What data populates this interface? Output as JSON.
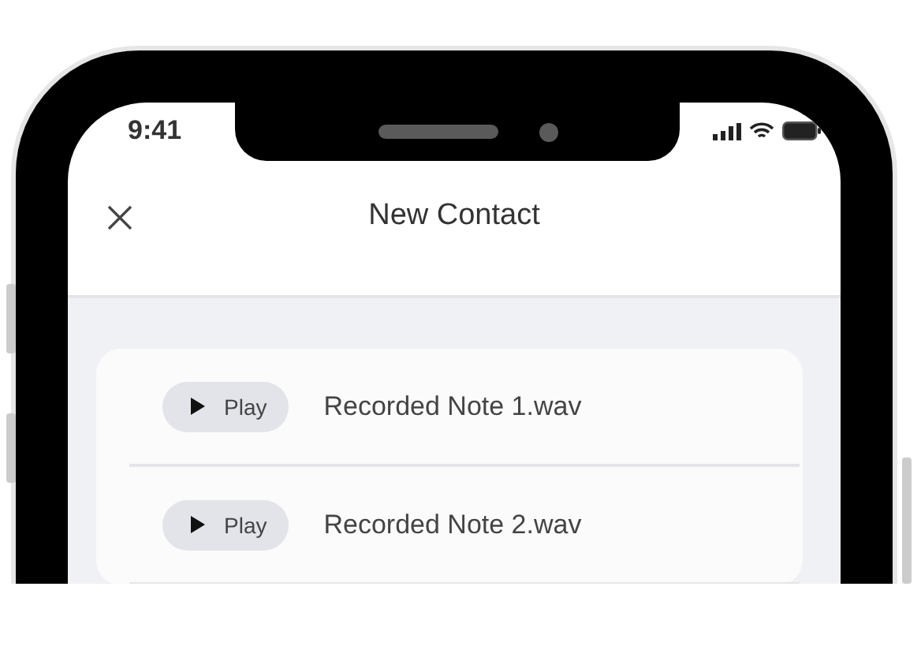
{
  "status_bar": {
    "time": "9:41"
  },
  "header": {
    "title": "New Contact"
  },
  "recordings": [
    {
      "button": "Play",
      "file_name": "Recorded Note 1.wav"
    },
    {
      "button": "Play",
      "file_name": "Recorded Note 2.wav"
    }
  ]
}
